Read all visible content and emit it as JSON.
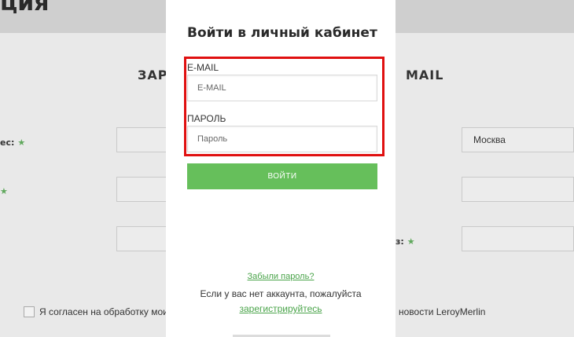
{
  "background": {
    "page_title": "ция",
    "section_left": "ЗАРЕ",
    "section_right": "MAIL",
    "label_address": "ес:",
    "label_required_star": "★",
    "label_short": "",
    "label_right": "з:",
    "city_value": "Москва",
    "consent_text": "Я согласен на обработку мои",
    "news_text": "новости LeroyMerlin"
  },
  "modal": {
    "title": "Войти в личный кабинет",
    "email_label": "E-MAIL",
    "email_placeholder": "E-MAIL",
    "password_label": "ПАРОЛЬ",
    "password_placeholder": "Пароль",
    "login_button": "ВОЙТИ",
    "forgot_password": "Забыли пароль?",
    "no_account_text": "Если у вас нет аккаунта, пожалуйста",
    "register_link": "зарегистрируйтесь"
  },
  "colors": {
    "accent_green": "#66bf5b",
    "link_green": "#4aa44a",
    "highlight_red": "#e01010"
  }
}
